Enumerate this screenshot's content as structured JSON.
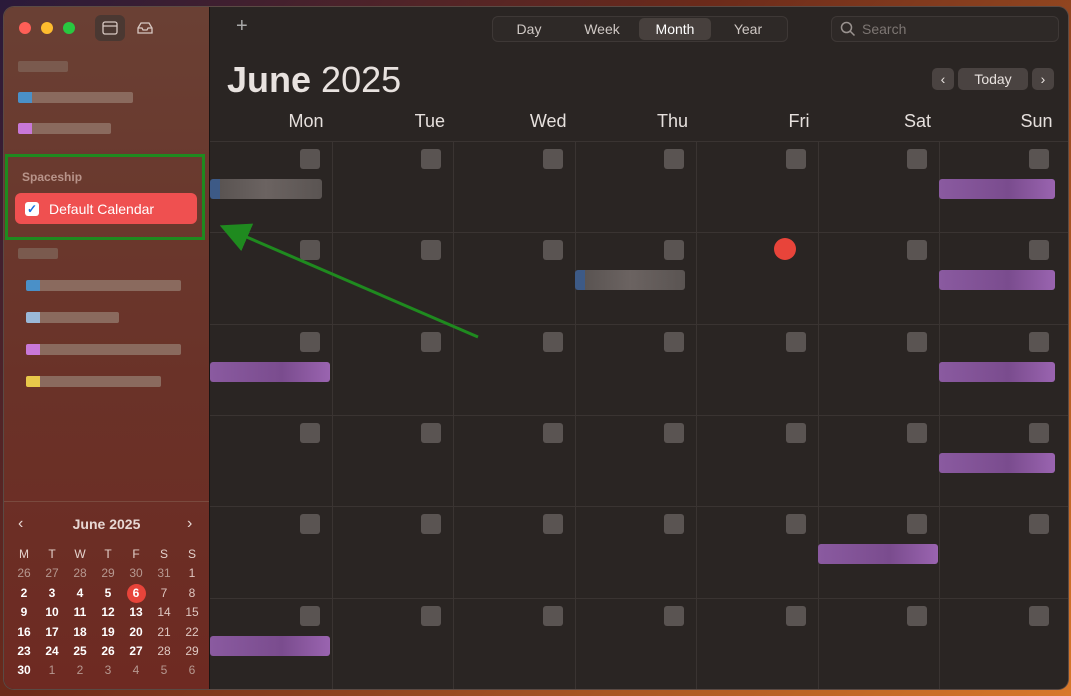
{
  "sidebar": {
    "section_title": "Spaceship",
    "calendar_item": {
      "label": "Default Calendar",
      "checked": true,
      "color": "#ef5050"
    }
  },
  "toolbar": {
    "add_label": "+",
    "views": [
      "Day",
      "Week",
      "Month",
      "Year"
    ],
    "active_view": "Month",
    "search_placeholder": "Search"
  },
  "header": {
    "month": "June",
    "year": "2025",
    "today_label": "Today",
    "prev_icon": "chevron-left-icon",
    "next_icon": "chevron-right-icon"
  },
  "weekdays": [
    "Mon",
    "Tue",
    "Wed",
    "Thu",
    "Fri",
    "Sat",
    "Sun"
  ],
  "mini_calendar": {
    "title": "June 2025",
    "weekdays": [
      "M",
      "T",
      "W",
      "T",
      "F",
      "S",
      "S"
    ],
    "weeks": [
      [
        "26",
        "27",
        "28",
        "29",
        "30",
        "31",
        "1"
      ],
      [
        "2",
        "3",
        "4",
        "5",
        "6",
        "7",
        "8"
      ],
      [
        "9",
        "10",
        "11",
        "12",
        "13",
        "14",
        "15"
      ],
      [
        "16",
        "17",
        "18",
        "19",
        "20",
        "21",
        "22"
      ],
      [
        "23",
        "24",
        "25",
        "26",
        "27",
        "28",
        "29"
      ],
      [
        "30",
        "1",
        "2",
        "3",
        "4",
        "5",
        "6"
      ]
    ],
    "today": "6"
  },
  "colors": {
    "accent": "#ef5050",
    "today": "#e8443a",
    "event_purple": "#8a5aa0",
    "highlight_box": "#1f8a1f"
  }
}
